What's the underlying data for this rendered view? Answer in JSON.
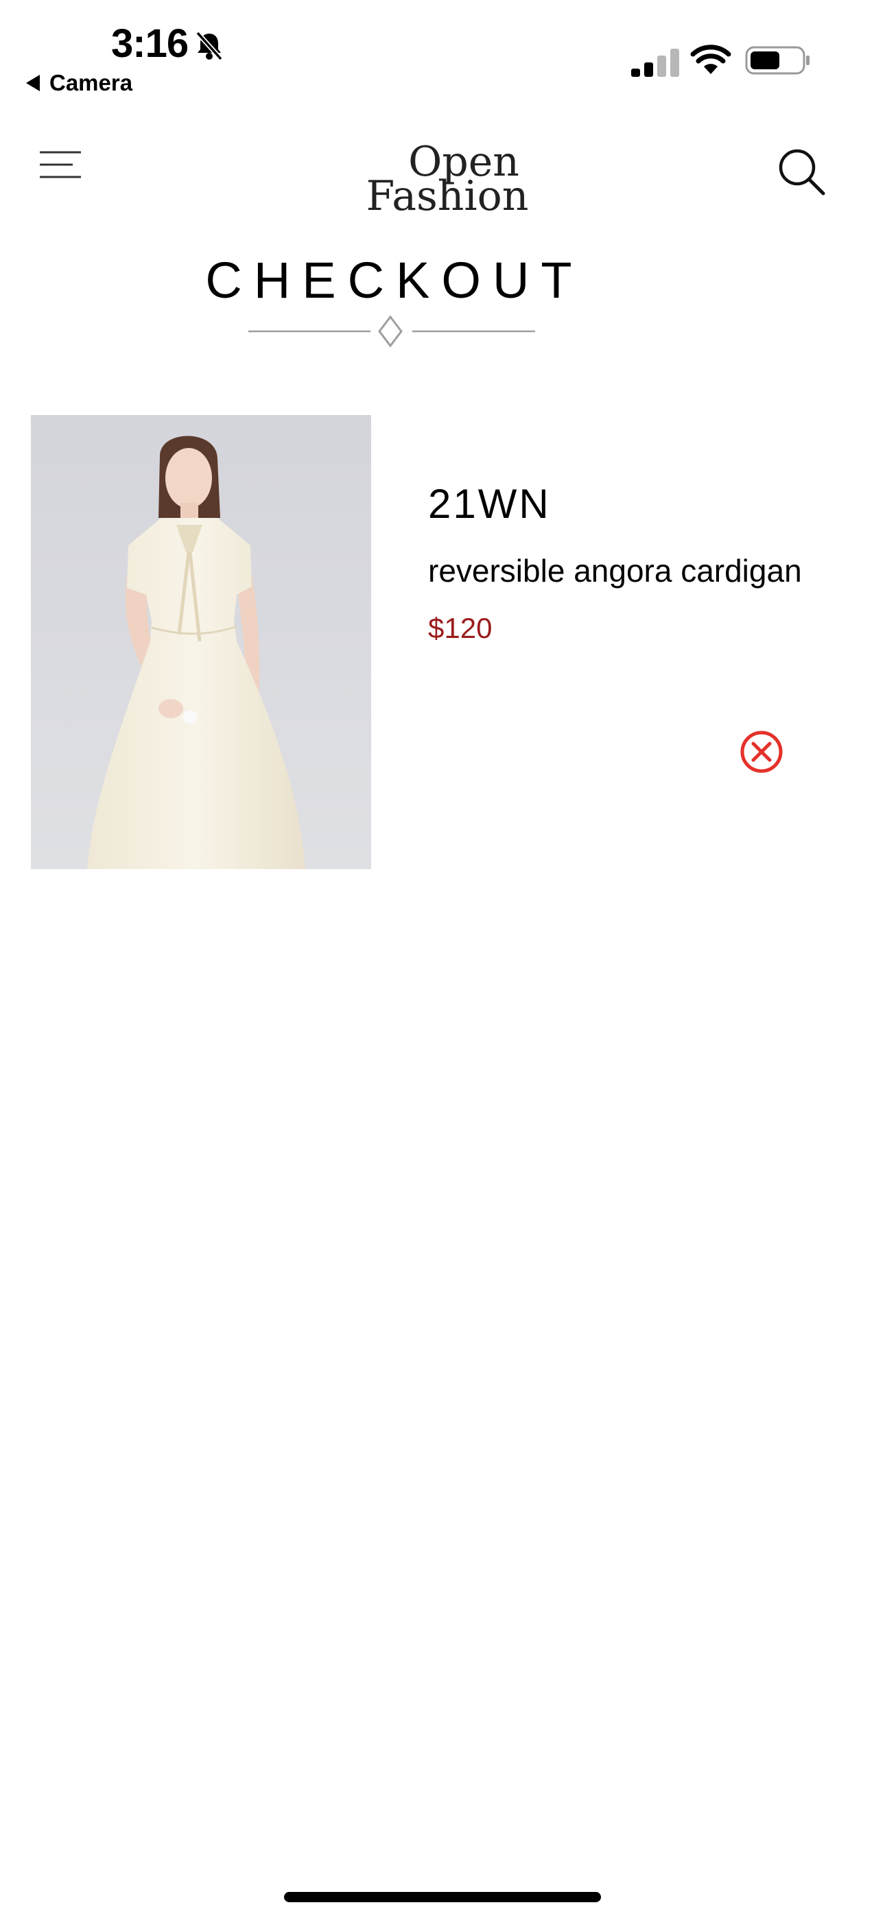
{
  "status_bar": {
    "time": "3:16",
    "back_label": "Camera",
    "icons": [
      "bell-slash-icon",
      "cellular-signal-icon",
      "wifi-icon",
      "battery-icon"
    ]
  },
  "header": {
    "logo_line1": "Open",
    "logo_line2": "Fashion",
    "menu_icon": "menu-icon",
    "search_icon": "search-icon"
  },
  "page": {
    "title": "CHECKOUT"
  },
  "cart_item": {
    "brand": "21WN",
    "name": "reversible angora cardigan",
    "price": "$120",
    "remove_icon": "remove-icon"
  },
  "colors": {
    "price": "#9b1c1c",
    "remove": "#e5312b",
    "divider": "#9e9e9e",
    "image_bg": "#dcdde2",
    "garment": "#f4efe1"
  }
}
